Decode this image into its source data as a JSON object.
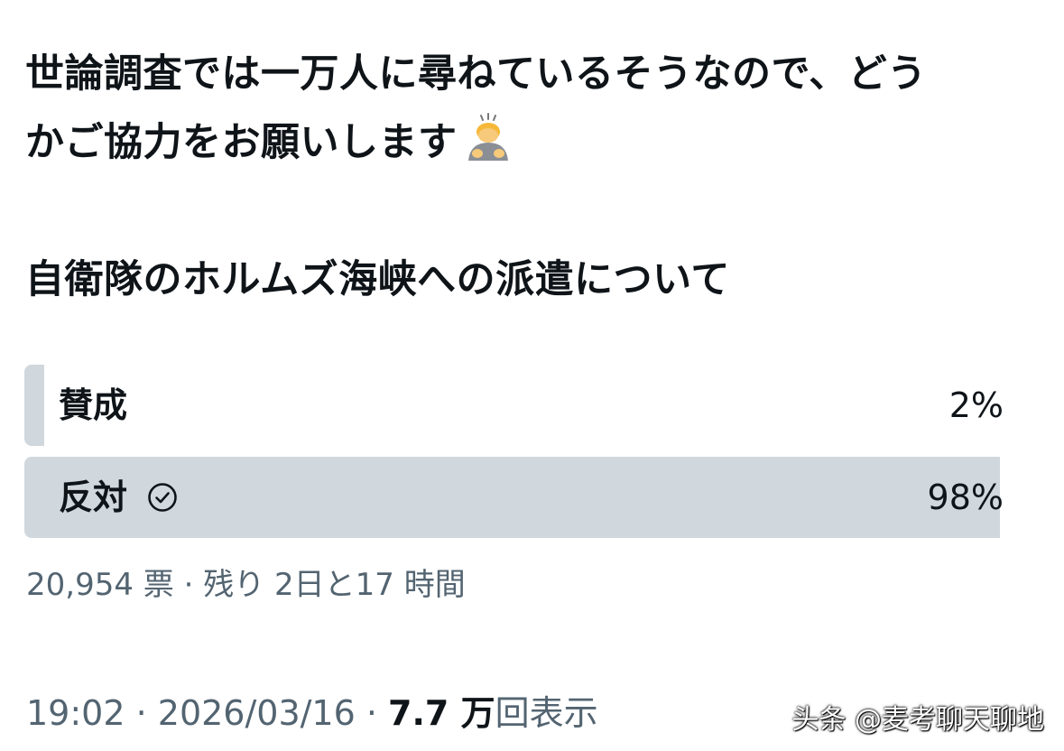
{
  "tweet": {
    "line1": "世論調査では一万人に尋ねているそうなので、どう",
    "line2": "かご協力をお願いします",
    "emoji": "person-bowing-icon",
    "line3": "自衛隊のホルムズ海峡への派遣について"
  },
  "poll": {
    "options": [
      {
        "label": "賛成",
        "percent_text": "2%",
        "percent": 2,
        "selected": false
      },
      {
        "label": "反対",
        "percent_text": "98%",
        "percent": 98,
        "selected": true
      }
    ],
    "votes_text": "20,954 票 · 残り 2日と17 時間"
  },
  "footer": {
    "time": "19:02",
    "separator": " · ",
    "date": "2026/03/16",
    "views_num": "7.7 万",
    "views_label": "回表示"
  },
  "watermark": "头条 @麦考聊天聊地",
  "colors": {
    "text": "#0f1419",
    "secondary": "#536471",
    "poll_bar": "#d0d8dd"
  }
}
